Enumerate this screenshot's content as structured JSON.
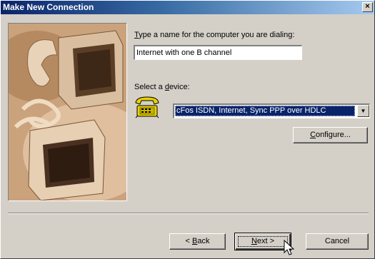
{
  "window": {
    "title": "Make New Connection",
    "close_glyph": "×"
  },
  "form": {
    "name_label_accel": "T",
    "name_label_rest": "ype a name for the computer you are dialing:",
    "name_value": "Internet with one B channel",
    "device_label_pre": "Select a ",
    "device_label_accel": "d",
    "device_label_rest": "evice:",
    "device_value": "cFos ISDN, Internet, Sync PPP over HDLC",
    "device_icon": "phone-modem-icon",
    "configure_accel": "C",
    "configure_rest": "onfigure..."
  },
  "buttons": {
    "back_pre": "< ",
    "back_accel": "B",
    "back_rest": "ack",
    "next_accel": "N",
    "next_rest": "ext >",
    "cancel": "Cancel"
  },
  "colors": {
    "title_start": "#0a246a",
    "title_end": "#a6caf0",
    "selection": "#0a246a",
    "face": "#d4d0c8"
  }
}
